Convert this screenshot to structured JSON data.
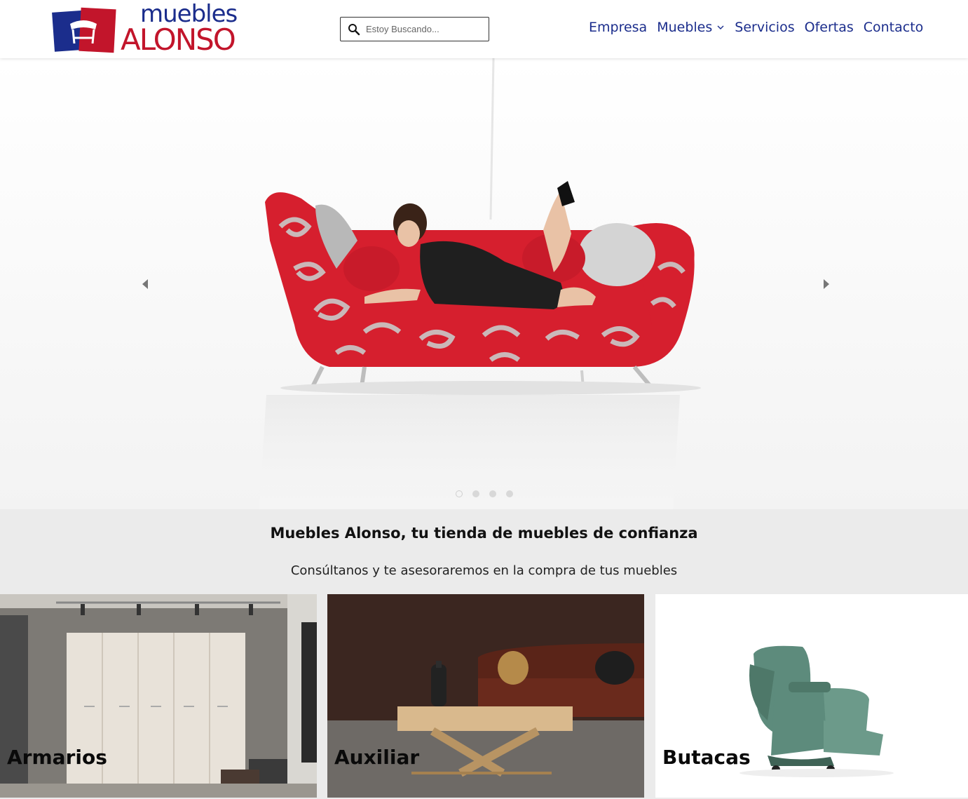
{
  "brand": {
    "logo_line1": "muebles",
    "logo_line2": "ALONSO",
    "colors": {
      "blue": "#1b2d8c",
      "red": "#c2152b"
    }
  },
  "search": {
    "placeholder": "Estoy Buscando...",
    "icon": "search-icon"
  },
  "nav": {
    "items": [
      {
        "label": "Empresa"
      },
      {
        "label": "Muebles",
        "has_dropdown": true
      },
      {
        "label": "Servicios"
      },
      {
        "label": "Ofertas"
      },
      {
        "label": "Contacto"
      }
    ]
  },
  "hero": {
    "slide_count": 4,
    "active_slide": 1
  },
  "intro": {
    "title": "Muebles Alonso, tu tienda de muebles de confianza",
    "subtitle": "Consúltanos y te asesoraremos en la compra de tus muebles"
  },
  "categories": [
    {
      "label": "Armarios"
    },
    {
      "label": "Auxiliar"
    },
    {
      "label": "Butacas"
    }
  ]
}
